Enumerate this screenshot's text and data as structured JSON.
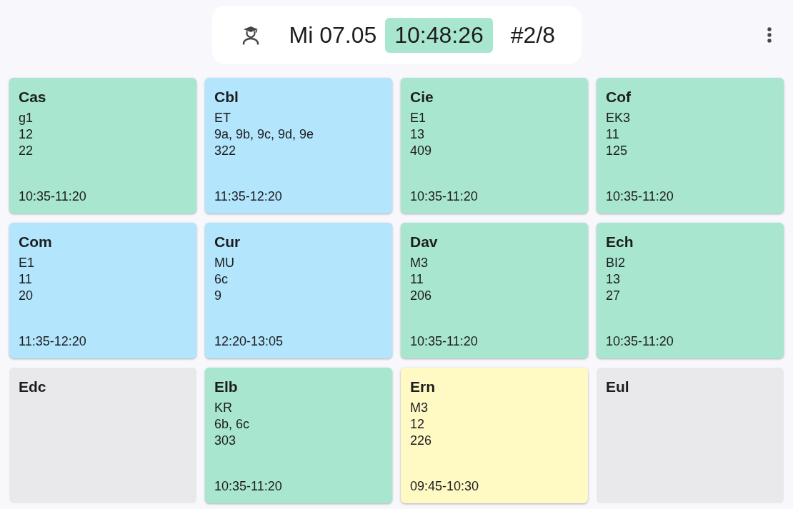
{
  "header": {
    "date": "Mi 07.05",
    "time": "10:48:26",
    "counter": "#2/8"
  },
  "cards": [
    {
      "name": "Cas",
      "lines": [
        "g1",
        "12",
        "22"
      ],
      "time": "10:35-11:20",
      "color": "#a8e6cf"
    },
    {
      "name": "Cbl",
      "lines": [
        "ET",
        "9a, 9b, 9c, 9d, 9e",
        "322"
      ],
      "time": "11:35-12:20",
      "color": "#b3e5fc"
    },
    {
      "name": "Cie",
      "lines": [
        "E1",
        "13",
        "409"
      ],
      "time": "10:35-11:20",
      "color": "#a8e6cf"
    },
    {
      "name": "Cof",
      "lines": [
        "EK3",
        "11",
        "125"
      ],
      "time": "10:35-11:20",
      "color": "#a8e6cf"
    },
    {
      "name": "Com",
      "lines": [
        "E1",
        "11",
        "20"
      ],
      "time": "11:35-12:20",
      "color": "#b3e5fc"
    },
    {
      "name": "Cur",
      "lines": [
        "MU",
        "6c",
        "9"
      ],
      "time": "12:20-13:05",
      "color": "#b3e5fc"
    },
    {
      "name": "Dav",
      "lines": [
        "M3",
        "11",
        "206"
      ],
      "time": "10:35-11:20",
      "color": "#a8e6cf"
    },
    {
      "name": "Ech",
      "lines": [
        "BI2",
        "13",
        "27"
      ],
      "time": "10:35-11:20",
      "color": "#a8e6cf"
    },
    {
      "name": "Edc",
      "color": "#e9e9eb"
    },
    {
      "name": "Elb",
      "lines": [
        "KR",
        "6b, 6c",
        "303"
      ],
      "time": "10:35-11:20",
      "color": "#a8e6cf"
    },
    {
      "name": "Ern",
      "lines": [
        "M3",
        "12",
        "226"
      ],
      "time": "09:45-10:30",
      "color": "#fff9c4"
    },
    {
      "name": "Eul",
      "color": "#e9e9eb"
    }
  ]
}
